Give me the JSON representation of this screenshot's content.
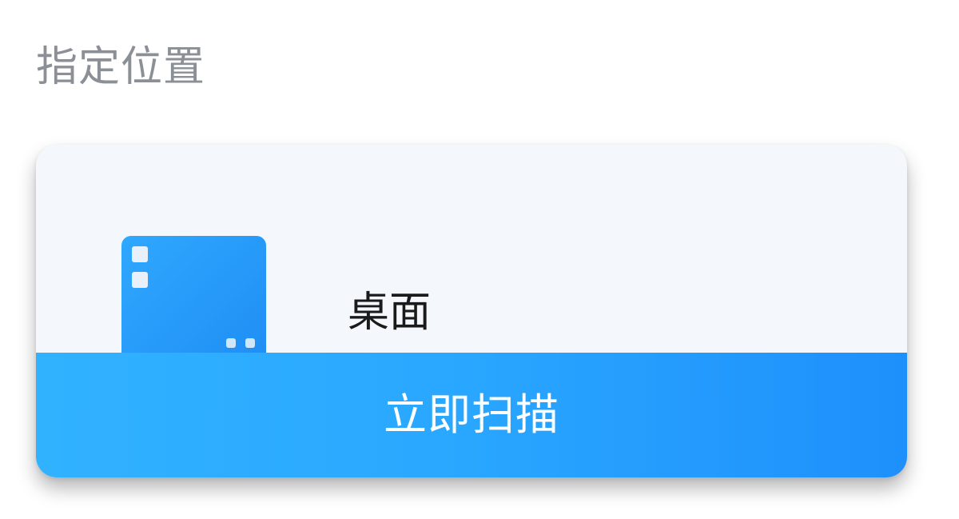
{
  "section": {
    "title": "指定位置"
  },
  "location": {
    "icon": "desktop-icon",
    "label": "桌面"
  },
  "scan_button": {
    "label": "立即扫描"
  },
  "colors": {
    "accent": "#2aa8ff",
    "accent_dark": "#1e90fb",
    "card_bg": "#f4f7fb",
    "title_text": "#8b8f96",
    "label_text": "#1a1a1a"
  }
}
